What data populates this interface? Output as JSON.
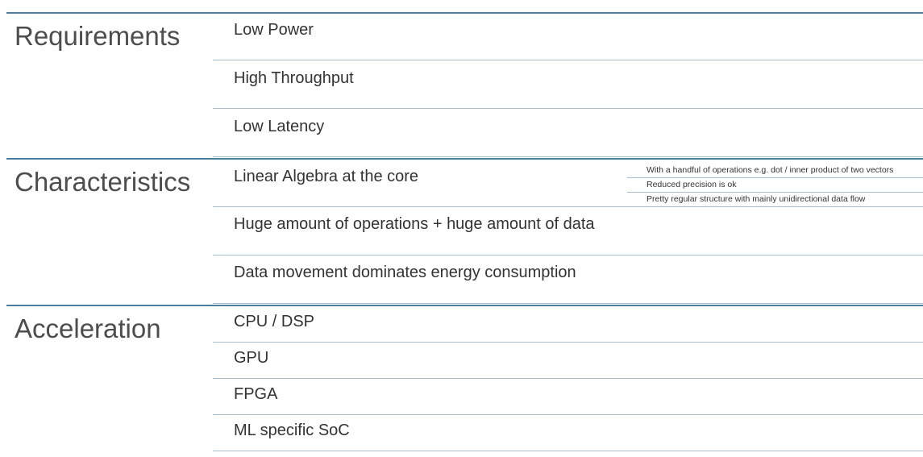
{
  "sections": [
    {
      "title": "Requirements",
      "items": [
        "Low Power",
        "High Throughput",
        "Low Latency"
      ]
    },
    {
      "title": "Characteristics",
      "items": [
        "Linear Algebra at the core",
        "Huge amount of operations + huge amount of data",
        "Data movement dominates energy consumption"
      ],
      "sub_items": [
        "With a handful of operations e.g. dot / inner product of two vectors",
        "Reduced precision is ok",
        "Pretty regular structure with mainly unidirectional data flow"
      ]
    },
    {
      "title": "Acceleration",
      "items": [
        "CPU / DSP",
        "GPU",
        "FPGA",
        "ML specific SoC"
      ]
    }
  ]
}
